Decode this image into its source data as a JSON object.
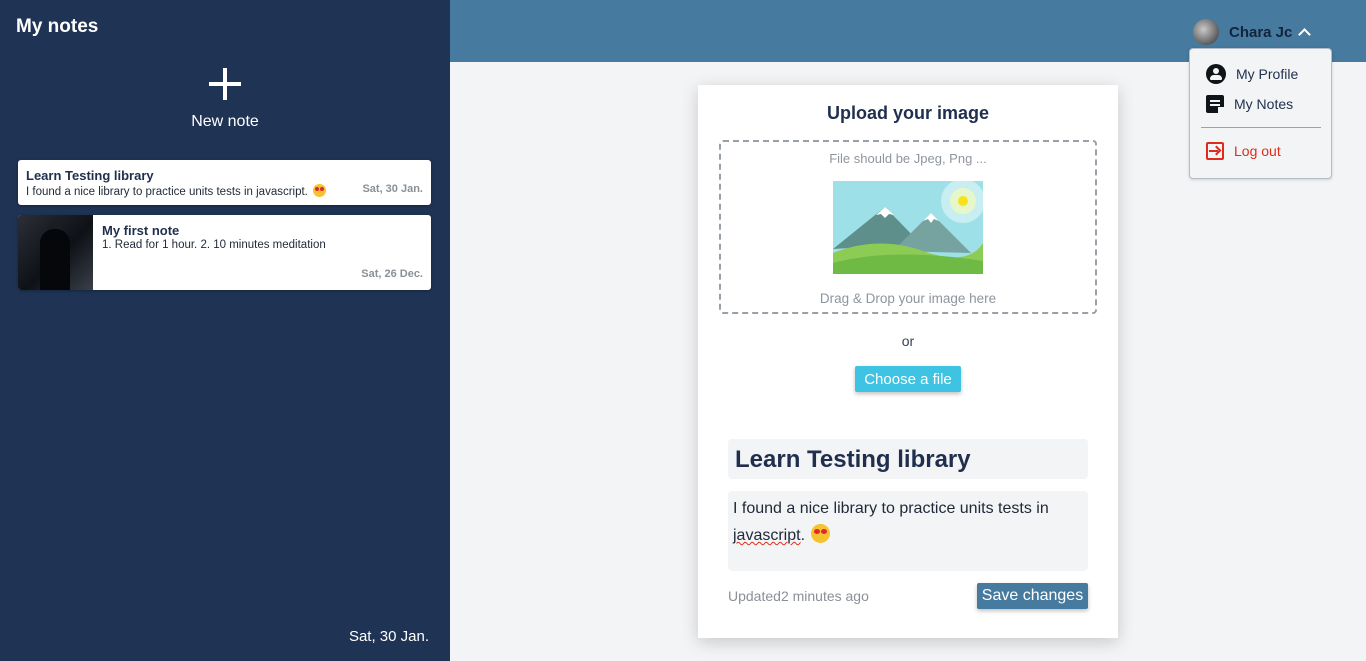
{
  "sidebar": {
    "title": "My notes",
    "new_note_label": "New note",
    "notes": [
      {
        "title": "Learn Testing library",
        "excerpt": "I found a nice library to practice units tests in javascript.",
        "date": "Sat, 30 Jan.",
        "emoji": "star-struck-emoji"
      },
      {
        "title": "My first note",
        "excerpt": "1. Read for 1 hour. 2. 10 minutes meditation",
        "date": "Sat, 26 Dec.",
        "thumbnail": "note-thumbnail-image"
      }
    ],
    "footer_date": "Sat, 30 Jan."
  },
  "header": {
    "user_name": "Chara Jc"
  },
  "user_dropdown": {
    "items": [
      {
        "label": "My Profile",
        "icon": "account-circle-icon"
      },
      {
        "label": "My Notes",
        "icon": "note-icon"
      },
      {
        "label": "Log out",
        "icon": "logout-icon"
      }
    ]
  },
  "editor": {
    "upload_title": "Upload your image",
    "dropzone_hint": "File should be Jpeg, Png ...",
    "dropzone_drop": "Drag & Drop your image here",
    "or_label": "or",
    "choose_file_label": "Choose a file",
    "note_title": "Learn Testing library",
    "note_body_prefix": "I found a nice library to practice units tests in",
    "note_body_word": "javascript",
    "note_body_suffix": ".",
    "updated_prefix": "Updated",
    "updated_value": "2 minutes ago",
    "save_label": "Save changes"
  },
  "colors": {
    "sidebar_bg": "#1f3354",
    "topbar_bg": "#467a9e",
    "choose_button": "#3ec4e2",
    "save_button": "#467a9e",
    "logout": "#e02b1c"
  }
}
